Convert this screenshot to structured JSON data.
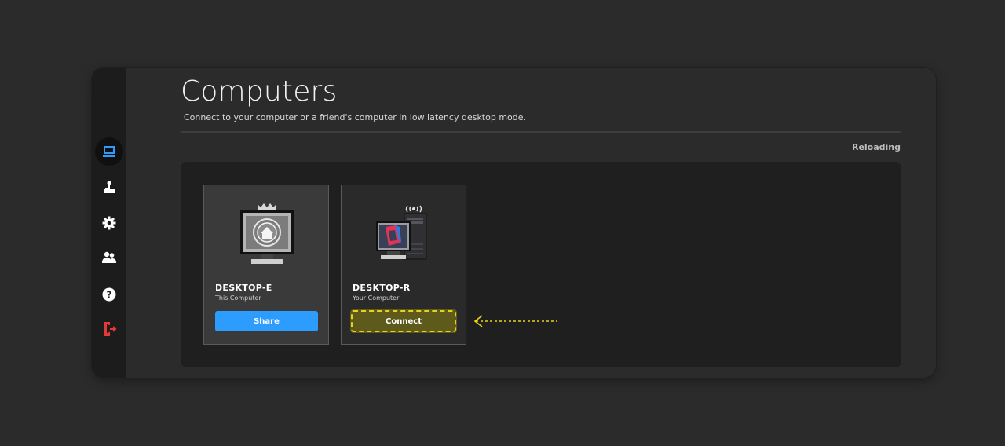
{
  "page": {
    "title": "Computers",
    "subtitle": "Connect to your computer or a friend's computer in low latency desktop mode.",
    "status": "Reloading"
  },
  "sidebar": {
    "items": [
      {
        "icon": "computer-icon",
        "active": true,
        "color": "#2d9cff"
      },
      {
        "icon": "joystick-icon",
        "active": false,
        "color": "#ffffff"
      },
      {
        "icon": "gear-icon",
        "active": false,
        "color": "#ffffff"
      },
      {
        "icon": "friends-icon",
        "active": false,
        "color": "#ffffff"
      },
      {
        "icon": "help-icon",
        "active": false,
        "color": "#ffffff"
      },
      {
        "icon": "logout-icon",
        "active": false,
        "color": "#e53935"
      }
    ]
  },
  "computers": [
    {
      "name": "DESKTOP-E",
      "description": "This Computer",
      "action": "Share",
      "icon": "home-monitor-icon",
      "accent": "#2d9cff"
    },
    {
      "name": "DESKTOP-R",
      "description": "Your Computer",
      "action": "Connect",
      "icon": "desktop-tower-icon",
      "accent": "#e8d21a"
    }
  ],
  "annotation": {
    "icon": "dashed-arrow-icon",
    "color": "#e8d21a"
  }
}
